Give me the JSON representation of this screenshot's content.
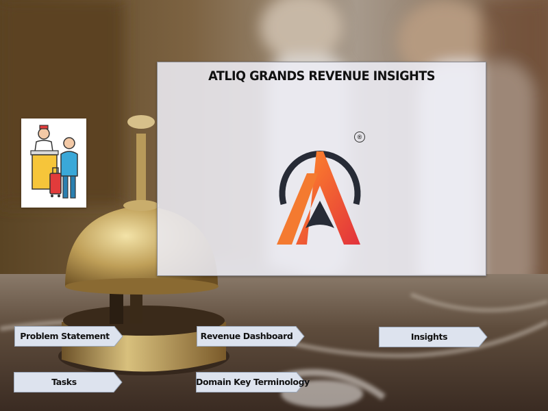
{
  "app": {
    "title": "ATLIQ GRANDS REVENUE INSIGHTS",
    "logo_mark": "®"
  },
  "icons": {
    "logo": "atliq-logo-icon",
    "hotel": "hotel-reception-icon"
  },
  "colors": {
    "logo_orange": "#f26b2c",
    "logo_red": "#e83a3a",
    "logo_arc": "#2b2f3a",
    "button_fill": "#dde3ee"
  },
  "nav": {
    "problem_statement": "Problem Statement",
    "revenue_dashboard": "Revenue Dashboard",
    "insights": "Insights",
    "tasks": "Tasks",
    "domain_key_terminology": "Domain Key Terminology"
  }
}
